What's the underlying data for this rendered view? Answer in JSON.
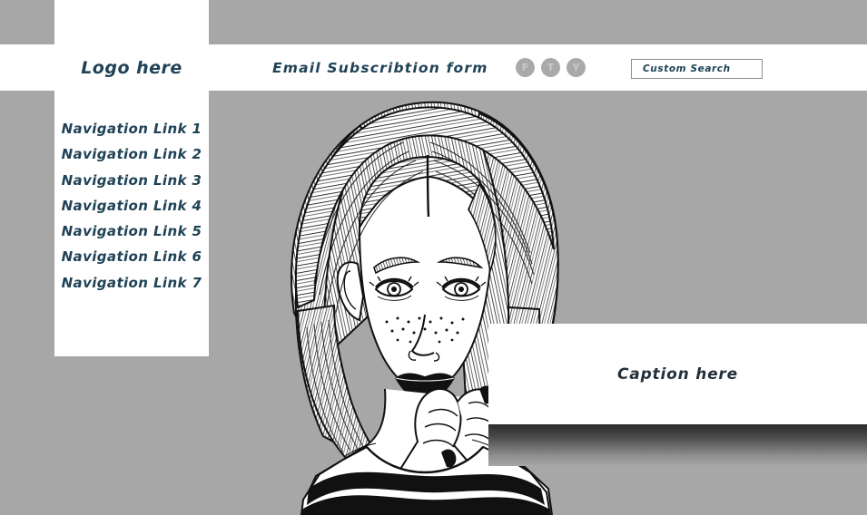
{
  "page": {
    "background_color": "#a7a7a7",
    "panel_color": "#ffffff",
    "accent_text_color": "#1f4257"
  },
  "header": {
    "logo_label": "Logo here",
    "subscription_label": "Email Subscribtion form",
    "social": [
      {
        "name": "facebook-icon",
        "letter": "F"
      },
      {
        "name": "twitter-icon",
        "letter": "T"
      },
      {
        "name": "youtube-icon",
        "letter": "Y"
      }
    ],
    "search": {
      "placeholder": "Custom Search",
      "value": ""
    }
  },
  "sidebar": {
    "items": [
      {
        "label": "Navigation Link 1"
      },
      {
        "label": "Navigation Link 2"
      },
      {
        "label": "Navigation Link 3"
      },
      {
        "label": "Navigation Link 4"
      },
      {
        "label": "Navigation Link 5"
      },
      {
        "label": "Navigation Link 6"
      },
      {
        "label": "Navigation Link 7"
      }
    ]
  },
  "hero": {
    "alt": "black-and-white line-art portrait of a young woman with shoulder-length hair, freckles and dark lipstick, hands raised near her chin, wearing a striped off-shoulder top"
  },
  "caption": {
    "text": "Caption here"
  }
}
